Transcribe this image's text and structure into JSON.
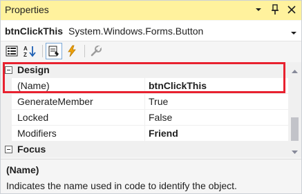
{
  "window": {
    "title": "Properties"
  },
  "object_selector": {
    "name": "btnClickThis",
    "type": "System.Windows.Forms.Button"
  },
  "toolbar": {
    "buttons": [
      "categorized-icon",
      "alphabetical-icon",
      "properties-icon",
      "events-icon",
      "property-pages-icon"
    ]
  },
  "grid": {
    "categories": [
      {
        "label": "Design",
        "expanded": true,
        "rows": [
          {
            "name": "(Name)",
            "value": "btnClickThis",
            "bold": true
          },
          {
            "name": "GenerateMember",
            "value": "True",
            "bold": false
          },
          {
            "name": "Locked",
            "value": "False",
            "bold": false
          },
          {
            "name": "Modifiers",
            "value": "Friend",
            "bold": true
          }
        ]
      },
      {
        "label": "Focus",
        "expanded": true,
        "rows": []
      }
    ]
  },
  "description": {
    "title": "(Name)",
    "text": "Indicates the name used in code to identify the object."
  },
  "colors": {
    "title_bar": "#fff29d",
    "highlight": "#e8212f",
    "category_bg": "#f0f0f0"
  }
}
